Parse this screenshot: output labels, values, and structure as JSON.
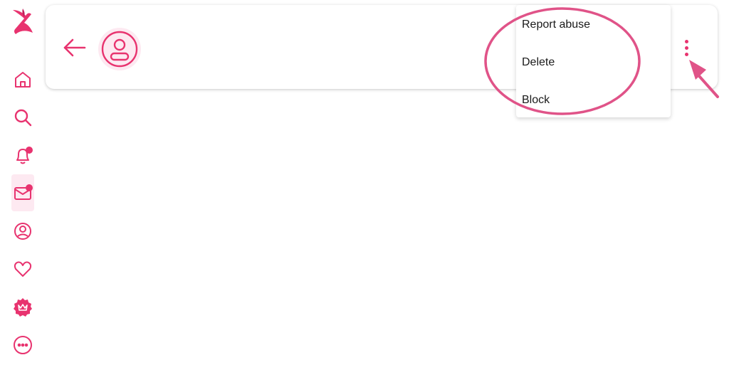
{
  "theme": {
    "accent": "#e8336f",
    "accent_soft": "#fde9f1"
  },
  "sidebar": {
    "logo": "brand-logo",
    "items": [
      {
        "name": "home",
        "icon": "home-icon"
      },
      {
        "name": "search",
        "icon": "search-icon"
      },
      {
        "name": "notifications",
        "icon": "bell-icon",
        "badge": true
      },
      {
        "name": "messages",
        "icon": "mail-icon",
        "badge": true,
        "active": true
      },
      {
        "name": "profile",
        "icon": "user-circle-icon"
      },
      {
        "name": "favorites",
        "icon": "heart-icon"
      },
      {
        "name": "premium",
        "icon": "crown-badge-icon"
      },
      {
        "name": "more",
        "icon": "more-circle-icon"
      }
    ]
  },
  "header": {
    "back_icon": "arrow-left-icon",
    "avatar_icon": "user-avatar-icon",
    "menu_icon": "kebab-menu-icon"
  },
  "menu": {
    "items": [
      "Report abuse",
      "Delete",
      "Block"
    ]
  }
}
